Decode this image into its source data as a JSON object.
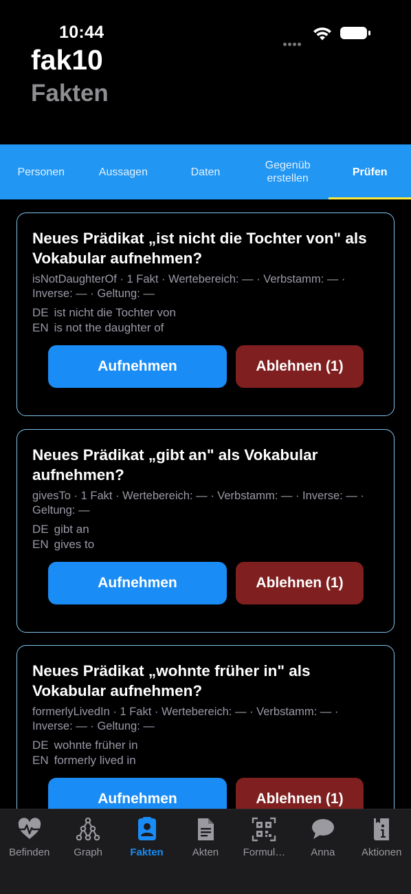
{
  "status_bar": {
    "time": "10:44"
  },
  "header": {
    "title": "fak10",
    "subtitle": "Fakten"
  },
  "top_tabs": [
    {
      "label": "Personen",
      "active": false
    },
    {
      "label": "Aussagen",
      "active": false
    },
    {
      "label": "Daten",
      "active": false
    },
    {
      "label": "Gegenüb\nerstellen",
      "active": false
    },
    {
      "label": "Prüfen",
      "active": true
    }
  ],
  "cards": [
    {
      "title": "Neues Prädikat „ist nicht die Tochter von\" als Vokabular aufnehmen?",
      "meta": "isNotDaughterOf · 1 Fakt · Wertebereich: — · Verbstamm: — · Inverse: — · Geltung: —",
      "de_code": "DE",
      "de_text": "ist nicht die Tochter von",
      "en_code": "EN",
      "en_text": "is not the daughter of",
      "accept_label": "Aufnehmen",
      "reject_label": "Ablehnen (1)"
    },
    {
      "title": "Neues Prädikat „gibt an\" als Vokabular aufnehmen?",
      "meta": "givesTo · 1 Fakt · Wertebereich: — · Verbstamm: — · Inverse: — · Geltung: —",
      "de_code": "DE",
      "de_text": "gibt an",
      "en_code": "EN",
      "en_text": "gives to",
      "accept_label": "Aufnehmen",
      "reject_label": "Ablehnen (1)"
    },
    {
      "title": "Neues Prädikat „wohnte früher in\" als Vokabular aufnehmen?",
      "meta": "formerlyLivedIn · 1 Fakt · Wertebereich: — · Verbstamm: — · Inverse: — · Geltung: —",
      "de_code": "DE",
      "de_text": "wohnte früher in",
      "en_code": "EN",
      "en_text": "formerly lived in",
      "accept_label": "Aufnehmen",
      "reject_label": "Ablehnen (1)"
    }
  ],
  "bottom_nav": [
    {
      "label": "Befinden",
      "icon": "heart-pulse-icon",
      "active": false
    },
    {
      "label": "Graph",
      "icon": "graph-icon",
      "active": false
    },
    {
      "label": "Fakten",
      "icon": "contact-book-icon",
      "active": true
    },
    {
      "label": "Akten",
      "icon": "document-icon",
      "active": false
    },
    {
      "label": "Formul…",
      "icon": "qr-code-icon",
      "active": false
    },
    {
      "label": "Anna",
      "icon": "chat-bubble-icon",
      "active": false
    },
    {
      "label": "Aktionen",
      "icon": "info-book-icon",
      "active": false
    }
  ],
  "colors": {
    "tab_bar": "#2196f3",
    "tab_indicator": "#ffeb3b",
    "accept": "#1a8cf5",
    "reject": "#7f1f1f",
    "card_border": "#7fc4ee",
    "nav_active": "#1a8cf5"
  }
}
